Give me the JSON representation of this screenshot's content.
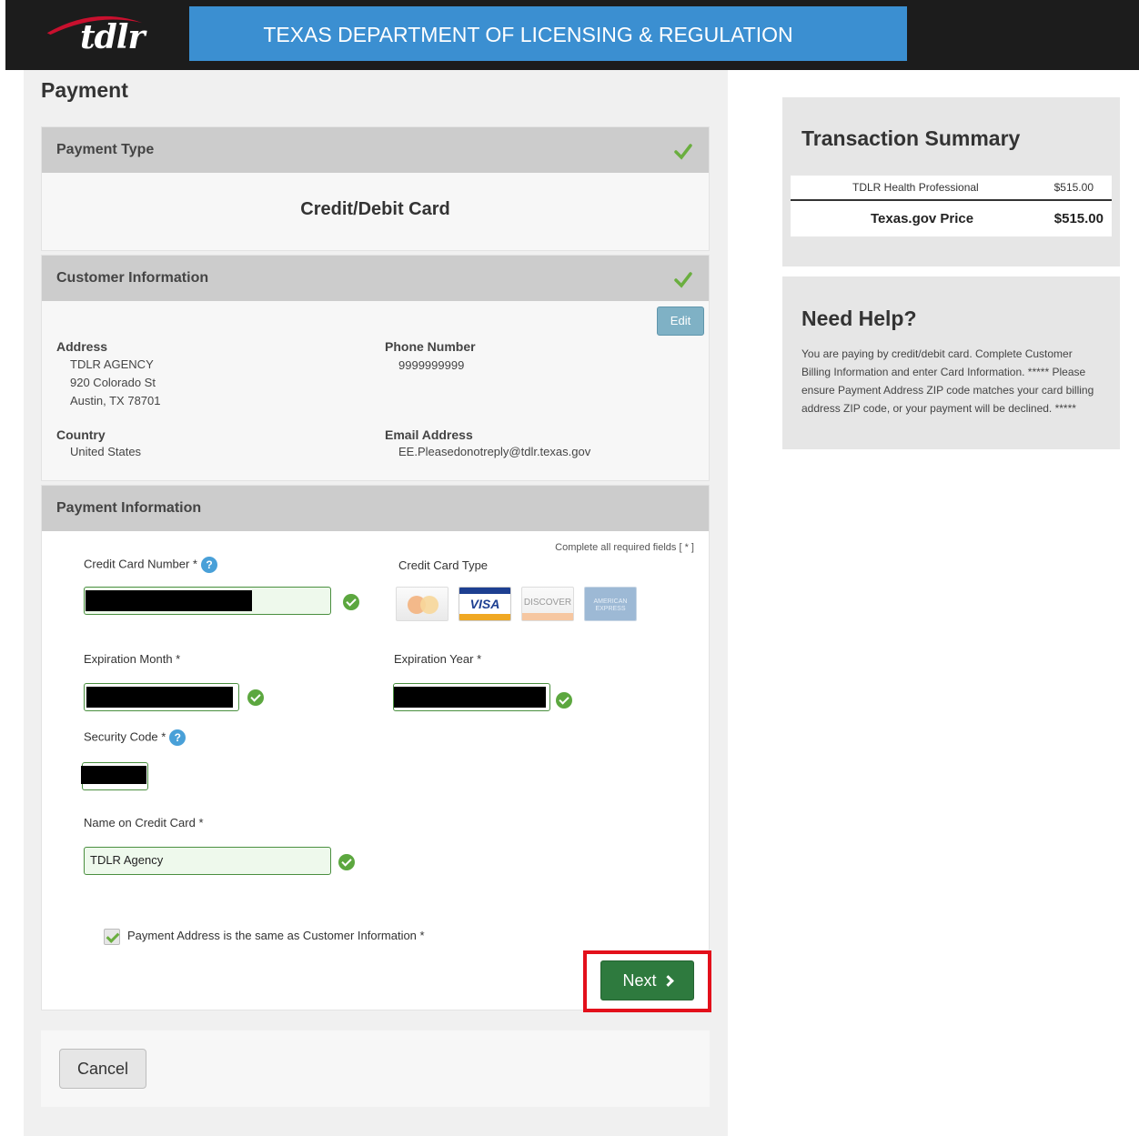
{
  "header": {
    "logo_text": "tdlr",
    "banner_title": "TEXAS DEPARTMENT OF LICENSING & REGULATION"
  },
  "page": {
    "title": "Payment"
  },
  "payment_type": {
    "heading": "Payment Type",
    "selected": "Credit/Debit Card"
  },
  "customer_info": {
    "heading": "Customer Information",
    "edit_label": "Edit",
    "address_label": "Address",
    "address_lines": [
      "TDLR AGENCY",
      "920 Colorado St",
      "Austin, TX 78701"
    ],
    "phone_label": "Phone Number",
    "phone_value": "9999999999",
    "country_label": "Country",
    "country_value": "United States",
    "email_label": "Email Address",
    "email_value": "EE.Pleasedonotreply@tdlr.texas.gov"
  },
  "payment_info": {
    "heading": "Payment Information",
    "required_note": "Complete all required fields [ * ]",
    "card_number_label": "Credit Card Number *",
    "card_type_label": "Credit Card Type",
    "card_types": [
      "MasterCard",
      "VISA",
      "DISCOVER",
      "AMERICAN EXPRESS"
    ],
    "exp_month_label": "Expiration Month *",
    "exp_year_label": "Expiration Year *",
    "security_code_label": "Security Code *",
    "name_label": "Name on Credit Card *",
    "name_value": "TDLR Agency",
    "same_address_label": "Payment Address is the same as Customer Information *",
    "same_address_checked": true,
    "help_glyph": "?"
  },
  "actions": {
    "next_label": "Next",
    "cancel_label": "Cancel"
  },
  "transaction_summary": {
    "title": "Transaction Summary",
    "item_desc": "TDLR Health Professional",
    "item_amount": "$515.00",
    "total_label": "Texas.gov Price",
    "total_amount": "$515.00"
  },
  "help": {
    "title": "Need Help?",
    "text": "You are paying by credit/debit card. Complete Customer Billing Information and enter Card Information. ***** Please ensure Payment Address ZIP code matches your card billing address ZIP code, or your payment will be declined. *****"
  },
  "colors": {
    "banner": "#3b8fd1",
    "next_button": "#2e7a3e",
    "valid_check": "#5ca73f",
    "highlight_frame": "#e3101b"
  },
  "icons": [
    "tdlr-logo",
    "check-icon",
    "help-icon",
    "valid-check-icon",
    "chevron-right-icon",
    "checkbox-checked-icon"
  ]
}
